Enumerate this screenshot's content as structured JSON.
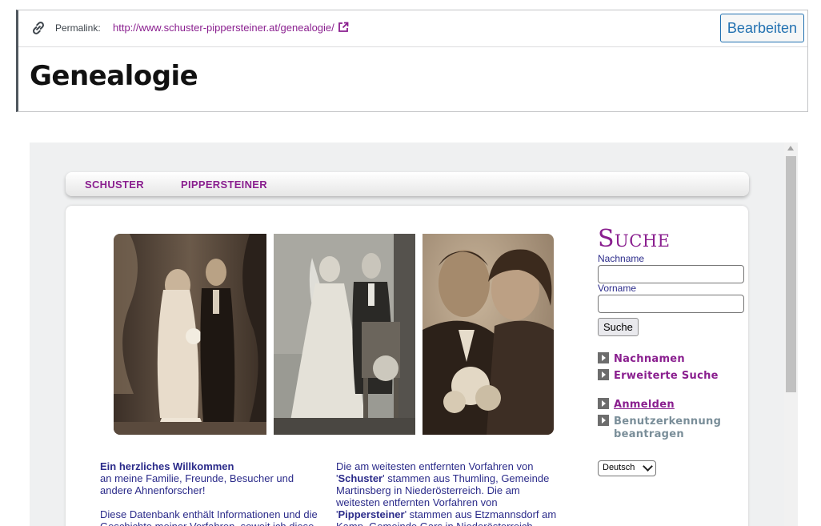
{
  "permalink": {
    "label": "Permalink:",
    "url": "http://www.schuster-pippersteiner.at/genealogie/",
    "edit_label": "Bearbeiten"
  },
  "page_title": "Genealogie",
  "nav": {
    "items": [
      {
        "label": "SCHUSTER"
      },
      {
        "label": "PIPPERSTEINER"
      }
    ]
  },
  "sidebar": {
    "heading": "Suche",
    "lastname_label": "Nachname",
    "firstname_label": "Vorname",
    "search_button": "Suche",
    "links": {
      "surnames": "Nachnamen",
      "advanced": "Erweiterte Suche",
      "login": "Anmelden",
      "request_account": "Benutzerkennung beantragen"
    },
    "language": "Deutsch"
  },
  "welcome": {
    "heading": "Ein herzliches Willkommen",
    "intro": "an meine Familie, Freunde, Besucher und andere Ahnenforscher!",
    "para2": "Diese Datenbank enthält Informationen und die Geschichte meiner Vorfahren, soweit ich diese"
  },
  "origins": {
    "text1": "Die am weitesten entfernten Vorfahren von '",
    "name1": "Schuster",
    "text2": "' stammen aus Thumling, Gemeinde Martinsberg in Niederösterreich. Die am weitesten entfernten Vorfahren von '",
    "name2": "Pippersteiner",
    "text3": "' stammen aus Etzmannsdorf am Kamp, Gemeinde Gars in Niederösterreich."
  },
  "colors": {
    "accent": "#8a1f8f",
    "body_text": "#2b2b8a",
    "wp_blue": "#2271b1",
    "frame_bg": "#eff0f1"
  },
  "icons": [
    "link-icon",
    "external-link-icon",
    "arrow-right-icon",
    "chevron-down-icon"
  ]
}
